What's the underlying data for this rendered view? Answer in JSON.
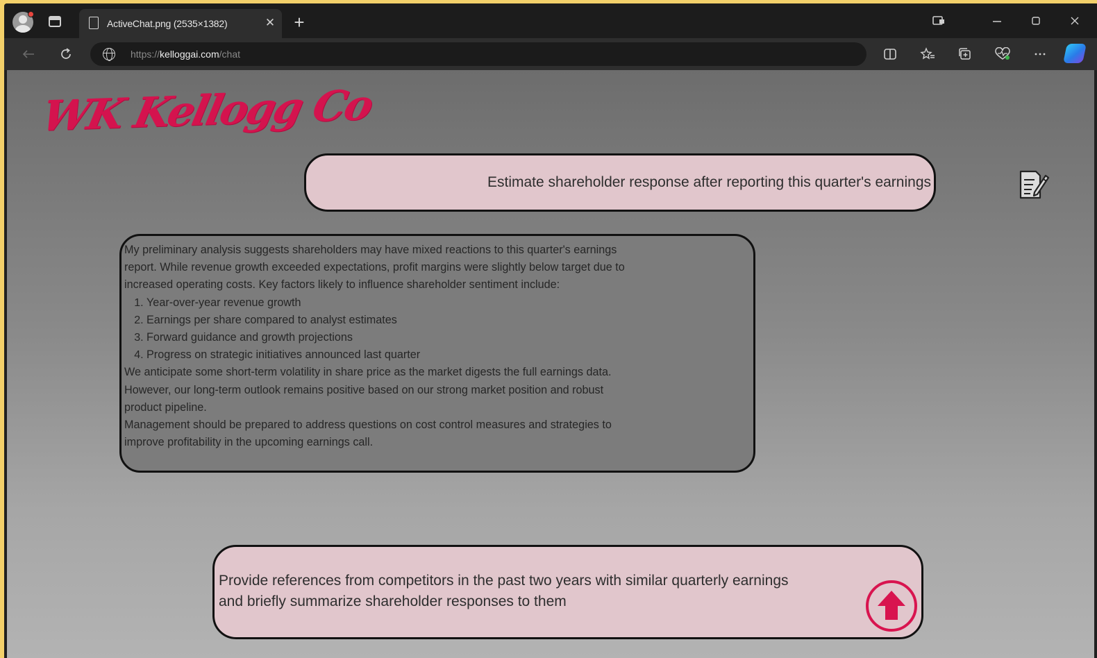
{
  "browser": {
    "tab_title": "ActiveChat.png (2535×1382)",
    "tab_close_glyph": "✕",
    "new_tab_glyph": "+",
    "url_scheme": "https://",
    "url_host": "kelloggai.com",
    "url_path": "/chat",
    "icons": [
      "profile-icon",
      "tab-actions-icon",
      "page-icon",
      "back-icon",
      "refresh-icon",
      "globe-icon",
      "split-screen-icon",
      "favorites-icon",
      "collections-icon",
      "browser-essentials-icon",
      "more-icon",
      "copilot-icon",
      "minimize-icon",
      "maximize-icon",
      "close-icon"
    ]
  },
  "brand": {
    "logo_text": "WK Kellogg Co",
    "logo_color": "#d4134e"
  },
  "chat": {
    "user_message": "Estimate shareholder response after reporting this quarter's earnings",
    "ai_response": {
      "intro": [
        "My preliminary analysis suggests shareholders may have mixed reactions to this quarter's earnings",
        "report. While revenue growth exceeded expectations, profit margins were slightly below target due to",
        "increased operating costs. Key factors likely to influence shareholder sentiment include:"
      ],
      "factors": [
        "Year-over-year revenue growth",
        "Earnings per share compared to analyst estimates",
        "Forward guidance and growth projections",
        "Progress on strategic initiatives announced last quarter"
      ],
      "outlook": [
        "We anticipate some short-term volatility in share price as the market digests the full earnings data.",
        "However, our long-term outlook remains positive based on our strong market position and robust",
        "product pipeline."
      ],
      "recommendation": [
        "Management should be prepared to address questions on cost control measures and strategies to",
        "improve profitability in the upcoming earnings call."
      ]
    },
    "input_value": "Provide references from competitors in the past two years with similar quarterly earnings\nand briefly summarize shareholder responses to them",
    "send_icon": "up-arrow-icon",
    "edit_icon": "edit-document-icon",
    "accent_color": "#d8144f",
    "bubble_color": "#e1c6cc"
  }
}
